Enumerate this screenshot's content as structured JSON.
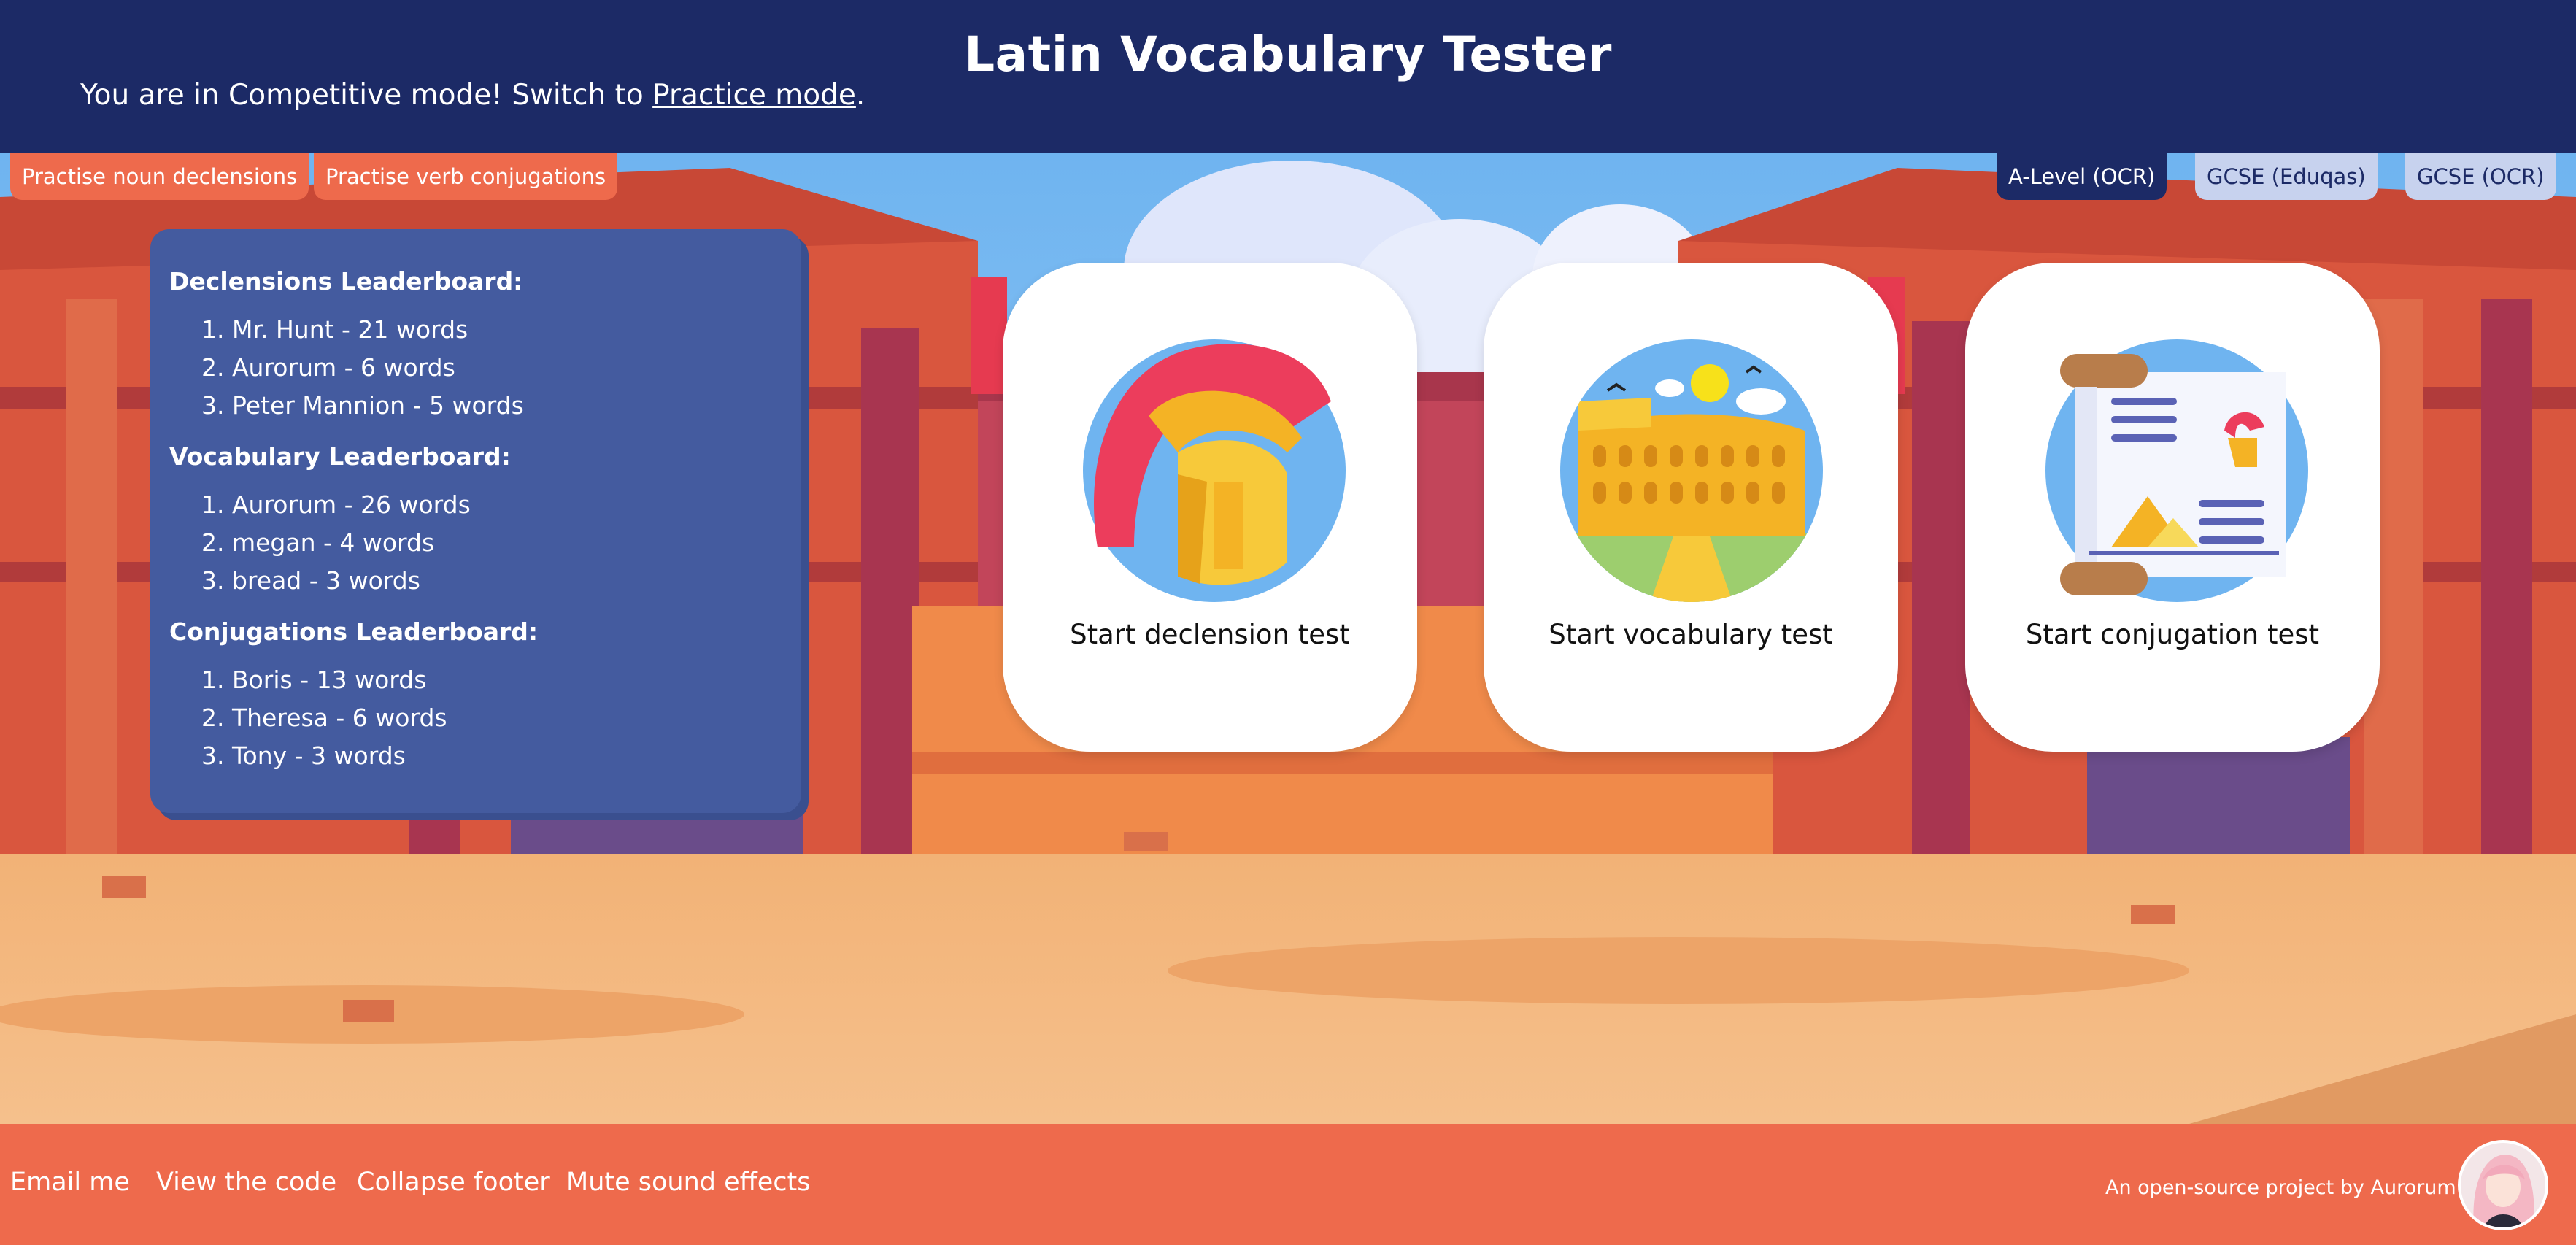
{
  "header": {
    "title": "Latin Vocabulary Tester",
    "mode_prefix": "You are in Competitive mode! Switch to ",
    "mode_link": "Practice mode",
    "mode_suffix": "."
  },
  "practice_buttons": [
    "Practise noun declensions",
    "Practise verb conjugations"
  ],
  "levels": [
    {
      "label": "A-Level (OCR)",
      "active": true
    },
    {
      "label": "GCSE (Eduqas)",
      "active": false
    },
    {
      "label": "GCSE (OCR)",
      "active": false
    }
  ],
  "leaderboards": [
    {
      "title": "Declensions Leaderboard:",
      "entries": [
        "1. Mr. Hunt - 21 words",
        "2. Aurorum - 6 words",
        "3. Peter Mannion - 5 words"
      ]
    },
    {
      "title": "Vocabulary Leaderboard:",
      "entries": [
        "1. Aurorum - 26 words",
        "2. megan - 4 words",
        "3. bread - 3 words"
      ]
    },
    {
      "title": "Conjugations Leaderboard:",
      "entries": [
        "1. Boris - 13 words",
        "2. Theresa - 6 words",
        "3. Tony - 3 words"
      ]
    }
  ],
  "tests": [
    {
      "label": "Start declension test",
      "icon": "roman-helmet-icon"
    },
    {
      "label": "Start vocabulary test",
      "icon": "colosseum-icon"
    },
    {
      "label": "Start conjugation test",
      "icon": "scroll-icon"
    }
  ],
  "footer": {
    "links": [
      "Email me",
      "View the code",
      "Collapse footer",
      "Mute sound effects"
    ],
    "credit": "An open-source project by Aurorum"
  },
  "colors": {
    "header_bg": "#1c2a66",
    "accent": "#ee6a4c",
    "board_bg": "#445b9f",
    "level_inactive": "#c7d2ee"
  }
}
